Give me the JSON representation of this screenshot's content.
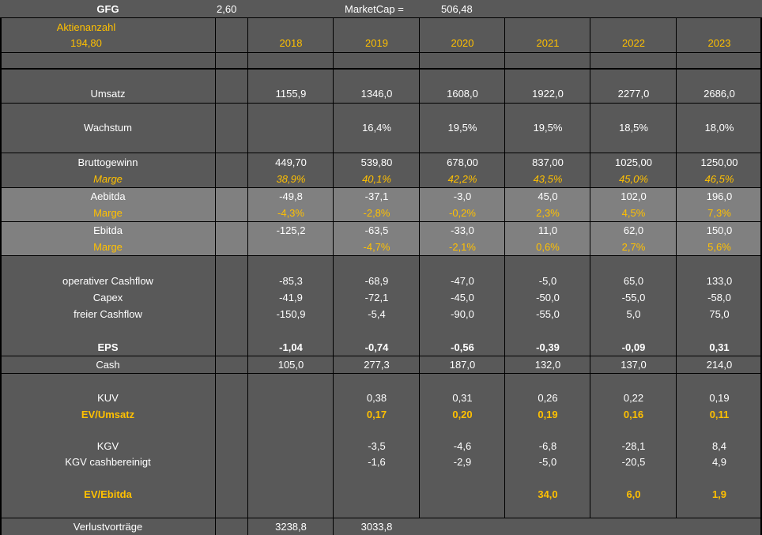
{
  "header": {
    "ticker": "GFG",
    "price": "2,60",
    "marketcap_label": "MarketCap =",
    "marketcap_value": "506,48",
    "shares_label": "Aktienanzahl",
    "shares_value": "194,80",
    "years": [
      "2018",
      "2019",
      "2020",
      "2021",
      "2022",
      "2023"
    ]
  },
  "rows": {
    "umsatz": {
      "label": "Umsatz",
      "values": [
        "1155,9",
        "1346,0",
        "1608,0",
        "1922,0",
        "2277,0",
        "2686,0"
      ]
    },
    "wachstum": {
      "label": "Wachstum",
      "values": [
        "",
        "16,4%",
        "19,5%",
        "19,5%",
        "18,5%",
        "18,0%"
      ]
    },
    "bruttogewinn": {
      "label": "Bruttogewinn",
      "values": [
        "449,70",
        "539,80",
        "678,00",
        "837,00",
        "1025,00",
        "1250,00"
      ]
    },
    "brutto_marge": {
      "label": "Marge",
      "values": [
        "38,9%",
        "40,1%",
        "42,2%",
        "43,5%",
        "45,0%",
        "46,5%"
      ]
    },
    "aebitda": {
      "label": "Aebitda",
      "values": [
        "-49,8",
        "-37,1",
        "-3,0",
        "45,0",
        "102,0",
        "196,0"
      ]
    },
    "aebitda_marge": {
      "label": "Marge",
      "values": [
        "-4,3%",
        "-2,8%",
        "-0,2%",
        "2,3%",
        "4,5%",
        "7,3%"
      ]
    },
    "ebitda": {
      "label": "Ebitda",
      "values": [
        "-125,2",
        "-63,5",
        "-33,0",
        "11,0",
        "62,0",
        "150,0"
      ]
    },
    "ebitda_marge": {
      "label": "Marge",
      "values": [
        "",
        "-4,7%",
        "-2,1%",
        "0,6%",
        "2,7%",
        "5,6%"
      ]
    },
    "op_cashflow": {
      "label": "operativer Cashflow",
      "values": [
        "-85,3",
        "-68,9",
        "-47,0",
        "-5,0",
        "65,0",
        "133,0"
      ]
    },
    "capex": {
      "label": "Capex",
      "values": [
        "-41,9",
        "-72,1",
        "-45,0",
        "-50,0",
        "-55,0",
        "-58,0"
      ]
    },
    "free_cashflow": {
      "label": "freier Cashflow",
      "values": [
        "-150,9",
        "-5,4",
        "-90,0",
        "-55,0",
        "5,0",
        "75,0"
      ]
    },
    "eps": {
      "label": "EPS",
      "values": [
        "-1,04",
        "-0,74",
        "-0,56",
        "-0,39",
        "-0,09",
        "0,31"
      ]
    },
    "cash": {
      "label": "Cash",
      "values": [
        "105,0",
        "277,3",
        "187,0",
        "132,0",
        "137,0",
        "214,0"
      ]
    },
    "kuv": {
      "label": "KUV",
      "values": [
        "",
        "0,38",
        "0,31",
        "0,26",
        "0,22",
        "0,19"
      ]
    },
    "ev_umsatz": {
      "label": "EV/Umsatz",
      "values": [
        "",
        "0,17",
        "0,20",
        "0,19",
        "0,16",
        "0,11"
      ]
    },
    "kgv": {
      "label": "KGV",
      "values": [
        "",
        "-3,5",
        "-4,6",
        "-6,8",
        "-28,1",
        "8,4"
      ]
    },
    "kgv_cash": {
      "label": "KGV cashbereinigt",
      "values": [
        "",
        "-1,6",
        "-2,9",
        "-5,0",
        "-20,5",
        "4,9"
      ]
    },
    "ev_ebitda": {
      "label": "EV/Ebitda",
      "values": [
        "",
        "",
        "",
        "34,0",
        "6,0",
        "1,9"
      ]
    },
    "verlustvortraege": {
      "label": "Verlustvorträge",
      "values": [
        "3238,8",
        "3033,8",
        "",
        "",
        "",
        ""
      ]
    }
  },
  "colors": {
    "background": "#595959",
    "band_light": "#808080",
    "gold": "#ffc000",
    "text": "#ffffff",
    "grid": "#000000"
  }
}
